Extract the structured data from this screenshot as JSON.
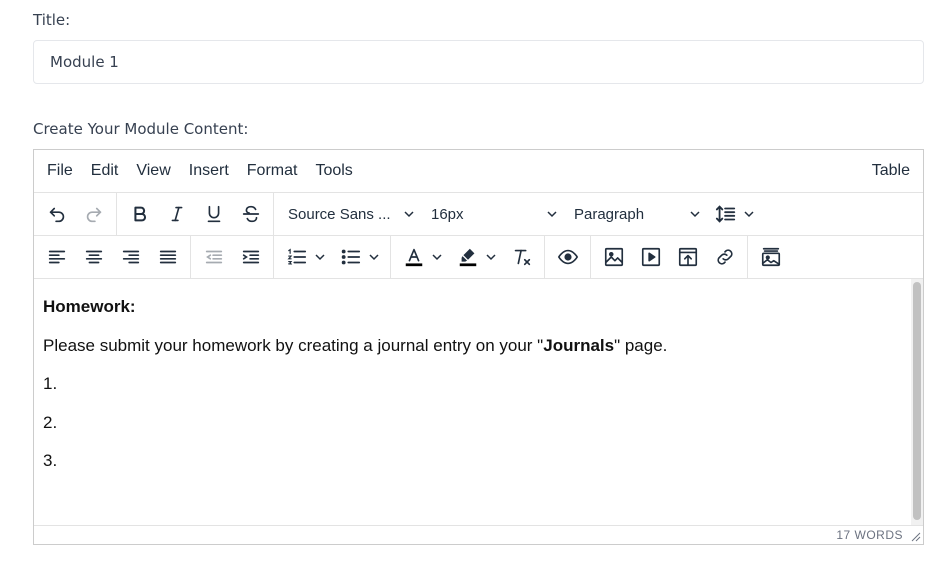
{
  "title_field": {
    "label": "Title:",
    "value": "Module 1"
  },
  "content_field": {
    "label": "Create Your Module Content:"
  },
  "menubar": {
    "items": [
      "File",
      "Edit",
      "View",
      "Insert",
      "Format",
      "Tools"
    ],
    "right_item": "Table"
  },
  "toolbar": {
    "font_family": "Source Sans ...",
    "font_size": "16px",
    "block_format": "Paragraph",
    "icons_row1": [
      "undo-icon",
      "redo-icon",
      "bold-icon",
      "italic-icon",
      "underline-icon",
      "strikethrough-icon",
      "line-height-icon"
    ],
    "icons_row2": [
      "align-left-icon",
      "align-center-icon",
      "align-right-icon",
      "align-justify-icon",
      "outdent-icon",
      "indent-icon",
      "numbered-list-icon",
      "bullet-list-icon",
      "text-color-icon",
      "highlight-icon",
      "clear-formatting-icon",
      "preview-icon",
      "image-icon",
      "media-icon",
      "embed-icon",
      "link-icon",
      "gallery-icon"
    ],
    "accent_text_color": "#222f3e"
  },
  "content": {
    "heading": "Homework:",
    "instruction_before": "Please submit your homework by creating a journal entry on your \"",
    "instruction_bold": "Journals",
    "instruction_after": "\" page.",
    "items": [
      "1.",
      "2.",
      "3."
    ]
  },
  "statusbar": {
    "word_count": "17 WORDS"
  }
}
